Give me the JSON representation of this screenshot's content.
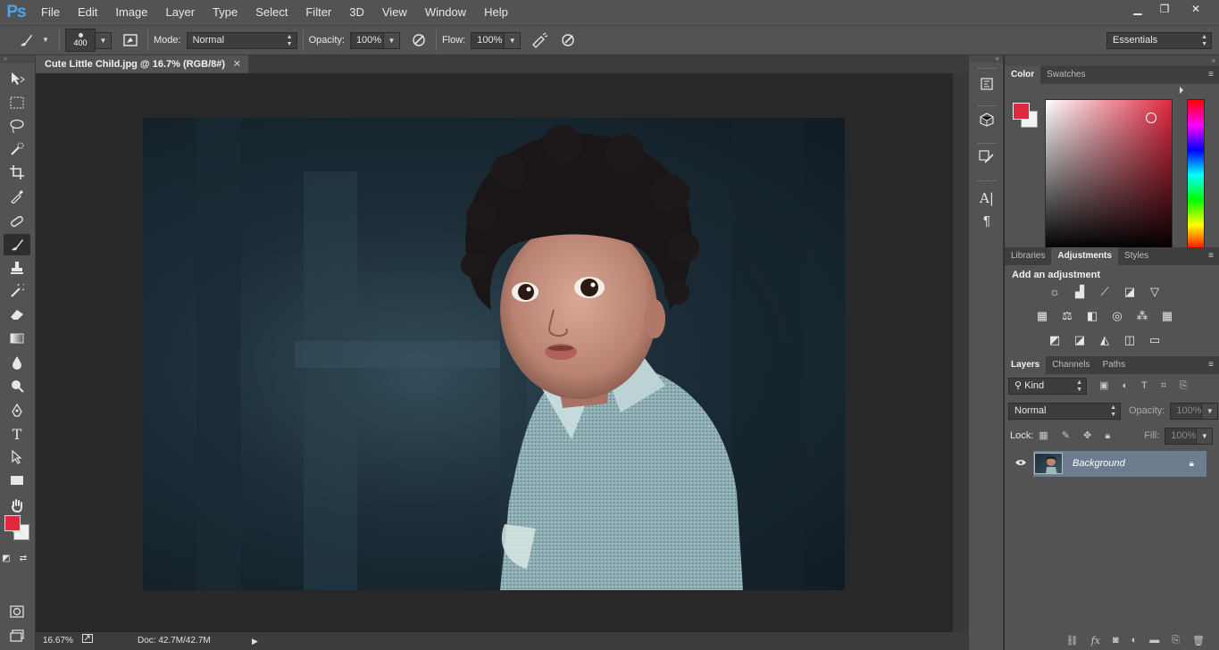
{
  "app": {
    "logo": "Ps"
  },
  "menu": [
    "File",
    "Edit",
    "Image",
    "Layer",
    "Type",
    "Select",
    "Filter",
    "3D",
    "View",
    "Window",
    "Help"
  ],
  "window_controls": {
    "minimize": "▁",
    "restore": "❐",
    "close": "✕"
  },
  "options_bar": {
    "brush_size": "400",
    "mode_label": "Mode:",
    "mode_value": "Normal",
    "opacity_label": "Opacity:",
    "opacity_value": "100%",
    "flow_label": "Flow:",
    "flow_value": "100%",
    "workspace": "Essentials"
  },
  "document": {
    "tab_title": "Cute Little Child.jpg @ 16.7% (RGB/8#)",
    "zoom": "16.67%",
    "doc_info": "Doc: 42.7M/42.7M"
  },
  "toolbar": {
    "tools": [
      "move-tool",
      "marquee-tool",
      "lasso-tool",
      "quick-selection-tool",
      "crop-tool",
      "eyedropper-tool",
      "healing-brush-tool",
      "brush-tool",
      "clone-stamp-tool",
      "history-brush-tool",
      "eraser-tool",
      "gradient-tool",
      "blur-tool",
      "dodge-tool",
      "pen-tool",
      "type-tool",
      "path-selection-tool",
      "rectangle-tool",
      "hand-tool",
      "zoom-tool"
    ],
    "active_tool": "brush-tool",
    "foreground_color": "#e0283f",
    "background_color": "#f1f1f1"
  },
  "color_panel": {
    "tabs": [
      "Color",
      "Swatches"
    ],
    "active_tab": "Color",
    "hue_color": "#e0283f"
  },
  "adjustments_panel": {
    "tabs": [
      "Libraries",
      "Adjustments",
      "Styles"
    ],
    "active_tab": "Adjustments",
    "title": "Add an adjustment"
  },
  "layers_panel": {
    "tabs": [
      "Layers",
      "Channels",
      "Paths"
    ],
    "active_tab": "Layers",
    "filter_kind": "Kind",
    "blend_mode": "Normal",
    "opacity_label": "Opacity:",
    "opacity_value": "100%",
    "lock_label": "Lock:",
    "fill_label": "Fill:",
    "fill_value": "100%",
    "layers": [
      {
        "name": "Background",
        "locked": true,
        "visible": true
      }
    ]
  },
  "colors": {
    "accent_red": "#e0283f",
    "selected_layer": "#6e7c90",
    "ui_panel": "#535353",
    "ps_blue": "#4aa6e8"
  }
}
